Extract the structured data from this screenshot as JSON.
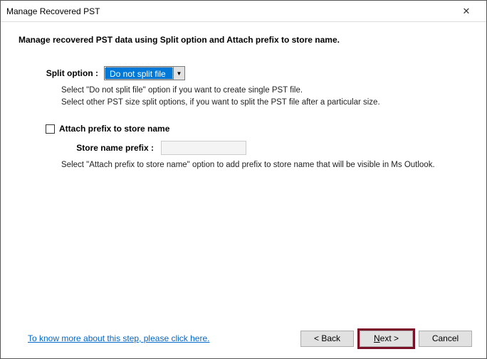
{
  "window": {
    "title": "Manage Recovered PST"
  },
  "heading": "Manage recovered PST data using Split option and Attach prefix to store name.",
  "split": {
    "label": "Split option :",
    "value": "Do not split file",
    "help_line1": "Select \"Do not split file\" option if you want to create single PST file.",
    "help_line2": "Select other PST size split options, if you want to split the PST file after a particular size."
  },
  "prefix": {
    "checkbox_label": "Attach prefix to store name",
    "checked": false,
    "field_label": "Store name prefix :",
    "value": "",
    "help": "Select \"Attach prefix to store name\" option to add prefix to store name that will be visible in Ms Outlook."
  },
  "footer": {
    "link": "To know more about this step, please click here.",
    "back": "< Back",
    "next_prefix": "N",
    "next_rest": "ext >",
    "cancel": "Cancel"
  }
}
